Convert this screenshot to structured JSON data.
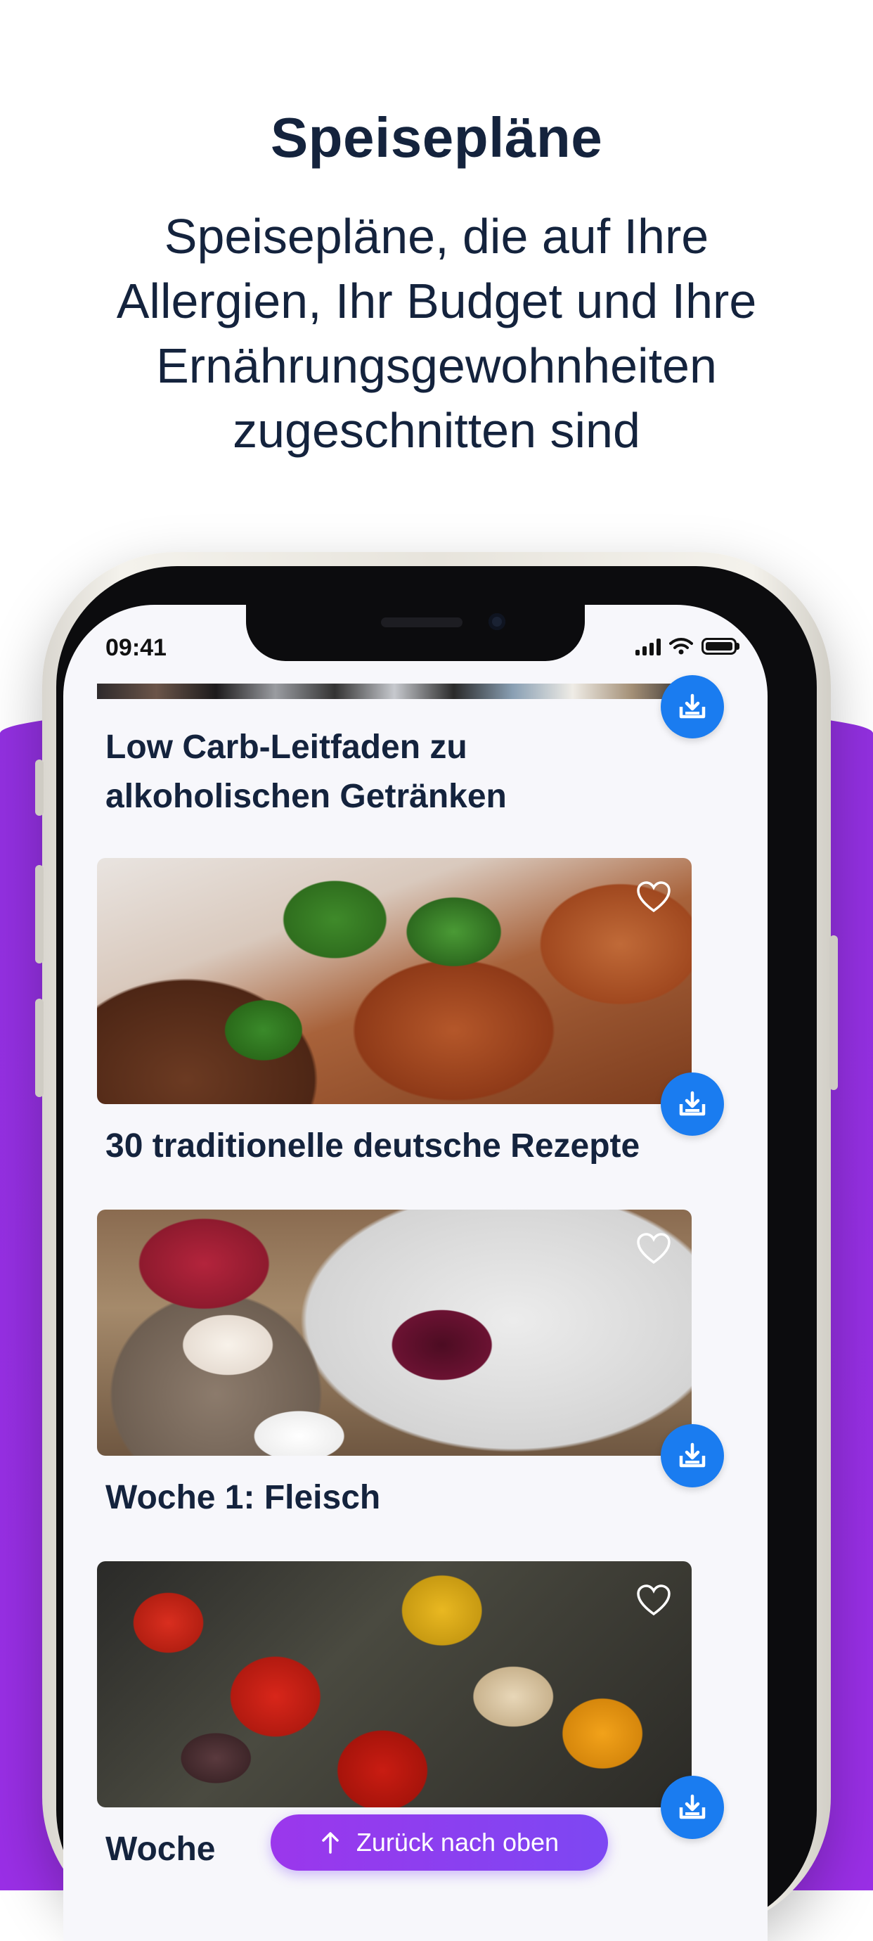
{
  "marketing": {
    "headline": "Speisepläne",
    "subline": "Speisepläne, die auf Ihre Allergien, Ihr Budget und Ihre Ernährungsgewohnheiten zugeschnitten sind"
  },
  "status_bar": {
    "time": "09:41",
    "icons": [
      "signal-icon",
      "wifi-icon",
      "battery-icon"
    ]
  },
  "cards": [
    {
      "title": "Low Carb-Leitfaden zu alkoholischen Getränken",
      "image": "drinks-photo"
    },
    {
      "title": "30 traditionelle deutsche Rezepte",
      "image": "goulash-photo"
    },
    {
      "title": "Woche 1: Fleisch",
      "image": "pancakes-berries-photo"
    },
    {
      "title": "Woche",
      "image": "vegetable-skewers-photo"
    }
  ],
  "back_to_top": {
    "label": "Zurück nach oben",
    "icon": "arrow-up-icon"
  },
  "colors": {
    "accent_purple": "#9230e0",
    "download_blue": "#1a7cf0",
    "text_navy": "#14233d"
  }
}
